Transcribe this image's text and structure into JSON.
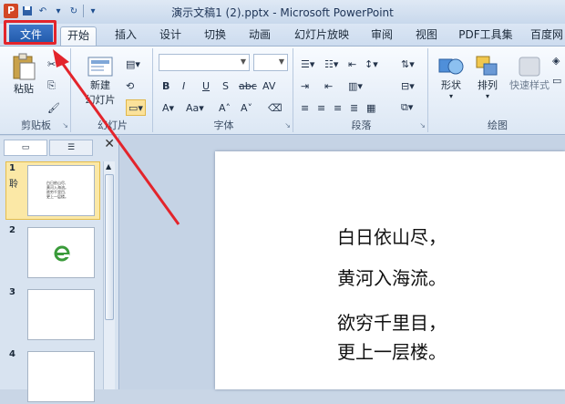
{
  "window": {
    "title": "演示文稿1 (2).pptx - Microsoft PowerPoint"
  },
  "tabs": [
    {
      "label": "文件"
    },
    {
      "label": "开始"
    },
    {
      "label": "插入"
    },
    {
      "label": "设计"
    },
    {
      "label": "切换"
    },
    {
      "label": "动画"
    },
    {
      "label": "幻灯片放映"
    },
    {
      "label": "审阅"
    },
    {
      "label": "视图"
    },
    {
      "label": "PDF工具集"
    },
    {
      "label": "百度网"
    }
  ],
  "ribbon": {
    "clipboard": {
      "label": "剪贴板",
      "paste": "粘贴"
    },
    "slides": {
      "label": "幻灯片",
      "new_line1": "新建",
      "new_line2": "幻灯片"
    },
    "font": {
      "label": "字体"
    },
    "paragraph": {
      "label": "段落"
    },
    "drawing": {
      "label": "绘图",
      "shape": "形状",
      "arrange": "排列",
      "quick_styles": "快速样式"
    }
  },
  "slide_pane": {
    "thumbnails": [
      {
        "number": "1"
      },
      {
        "number": "2"
      },
      {
        "number": "3"
      },
      {
        "number": "4"
      }
    ],
    "thumb1_icon": "聆",
    "thumb1_lines": [
      "白日依山尽,",
      "黄河入海流。",
      "欲穷千里目,",
      "更上一层楼。"
    ]
  },
  "slide": {
    "lines": [
      "白日依山尽，",
      "黄河入海流。",
      "欲穷千里目，",
      "更上一层楼。"
    ]
  },
  "colors": {
    "file_tab": "#2a62b3",
    "annotation": "#e3242b",
    "thumb_selected": "#fbe8a6"
  }
}
